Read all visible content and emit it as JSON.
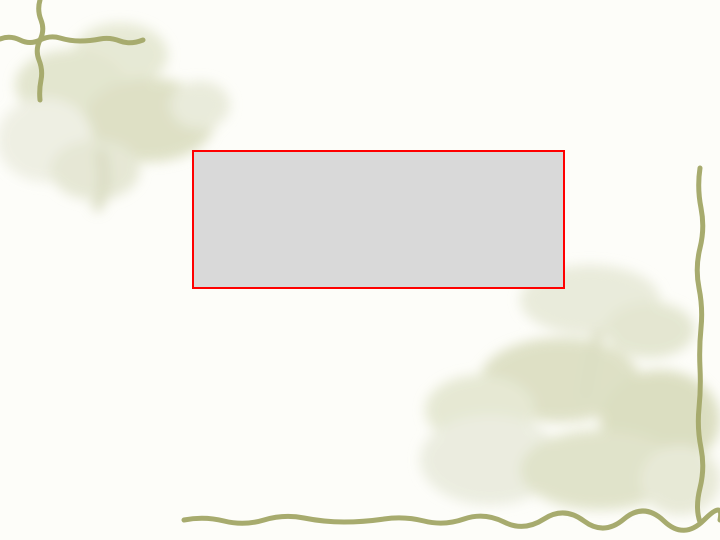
{
  "slide": {
    "placeholder_text": ""
  },
  "colors": {
    "background": "#fdfdf9",
    "placeholder_fill": "#d9d9d9",
    "placeholder_border": "#ff0000",
    "vine": "#a7ab6e",
    "flower_tint": "#dde0c6"
  },
  "icons": {
    "top_left": "floral-corner-top-left",
    "bottom_right": "floral-corner-bottom-right"
  }
}
